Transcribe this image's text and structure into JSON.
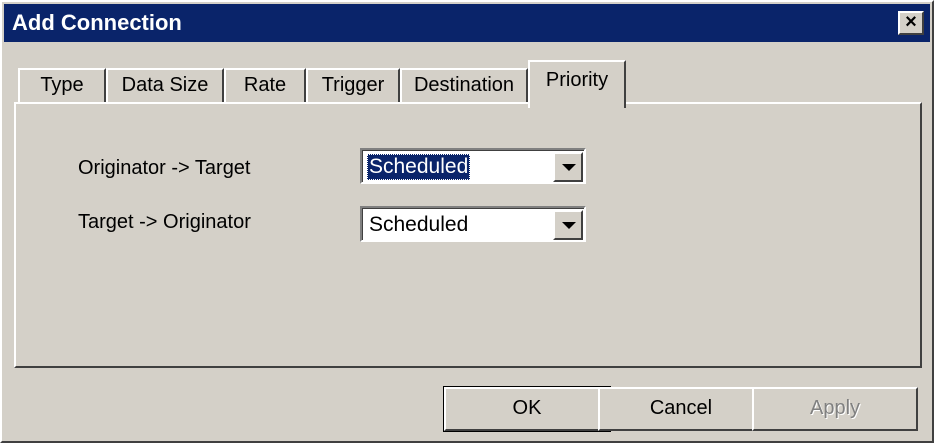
{
  "window": {
    "title": "Add Connection",
    "close_glyph": "×"
  },
  "tabs": [
    {
      "label": "Type"
    },
    {
      "label": "Data Size"
    },
    {
      "label": "Rate"
    },
    {
      "label": "Trigger"
    },
    {
      "label": "Destination"
    },
    {
      "label": "Priority",
      "active": true
    }
  ],
  "priority": {
    "originator_to_target": {
      "label": "Originator -> Target",
      "value": "Scheduled"
    },
    "target_to_originator": {
      "label": "Target -> Originator",
      "value": "Scheduled"
    }
  },
  "buttons": {
    "ok": "OK",
    "cancel": "Cancel",
    "apply": "Apply"
  }
}
